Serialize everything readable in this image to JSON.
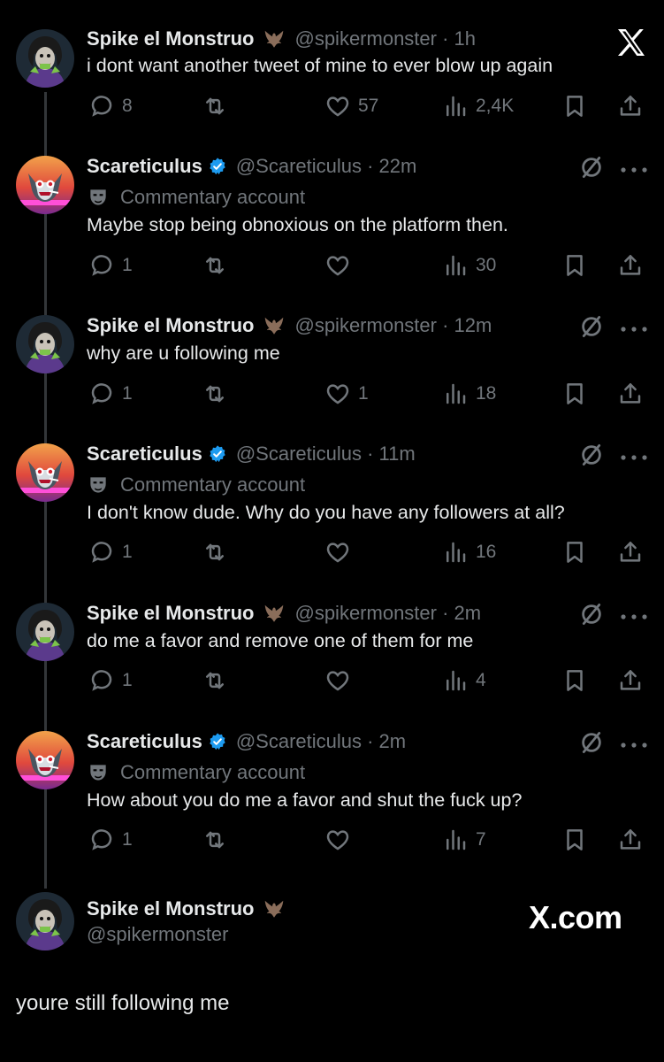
{
  "app": {
    "logo_icon": "x-logo-icon",
    "watermark": "X.com"
  },
  "accounts": {
    "spike": {
      "name": "Spike el Monstruo",
      "handle": "@spikermonster",
      "badge_icon": "bat-emoji-icon"
    },
    "scare": {
      "name": "Scareticulus",
      "handle": "@Scareticulus",
      "verified_icon": "verified-badge-icon",
      "affiliation": "Commentary account",
      "affiliation_icon": "mask-icon"
    }
  },
  "tweets": [
    {
      "author": "spike",
      "meta": "@spikermonster · 1h",
      "text": "i dont want another tweet of mine to ever blow up again",
      "replies": "8",
      "reposts": "",
      "likes": "57",
      "views": "2,4K"
    },
    {
      "author": "scare",
      "meta": "@Scareticulus · 22m",
      "text": "Maybe stop being obnoxious on the platform then.",
      "replies": "1",
      "reposts": "",
      "likes": "",
      "views": "30"
    },
    {
      "author": "spike",
      "meta": "@spikermonster · 12m",
      "text": "why are u following me",
      "replies": "1",
      "reposts": "",
      "likes": "1",
      "views": "18"
    },
    {
      "author": "scare",
      "meta": "@Scareticulus · 11m",
      "text": "I don't know dude. Why do you have any followers at all?",
      "replies": "1",
      "reposts": "",
      "likes": "",
      "views": "16"
    },
    {
      "author": "spike",
      "meta": "@spikermonster · 2m",
      "text": "do me a favor and remove one of them for me",
      "replies": "1",
      "reposts": "",
      "likes": "",
      "views": "4"
    },
    {
      "author": "scare",
      "meta": "@Scareticulus · 2m",
      "text": "How about you do me a favor and shut the fuck up?",
      "replies": "1",
      "reposts": "",
      "likes": "",
      "views": "7"
    }
  ],
  "quote": {
    "name": "Spike el Monstruo",
    "handle": "@spikermonster",
    "text": "youre still following me"
  },
  "colors": {
    "background": "#000000",
    "text": "#e7e9ea",
    "secondary": "#71767b",
    "verified": "#1d9bf0",
    "thread_line": "#333639"
  }
}
